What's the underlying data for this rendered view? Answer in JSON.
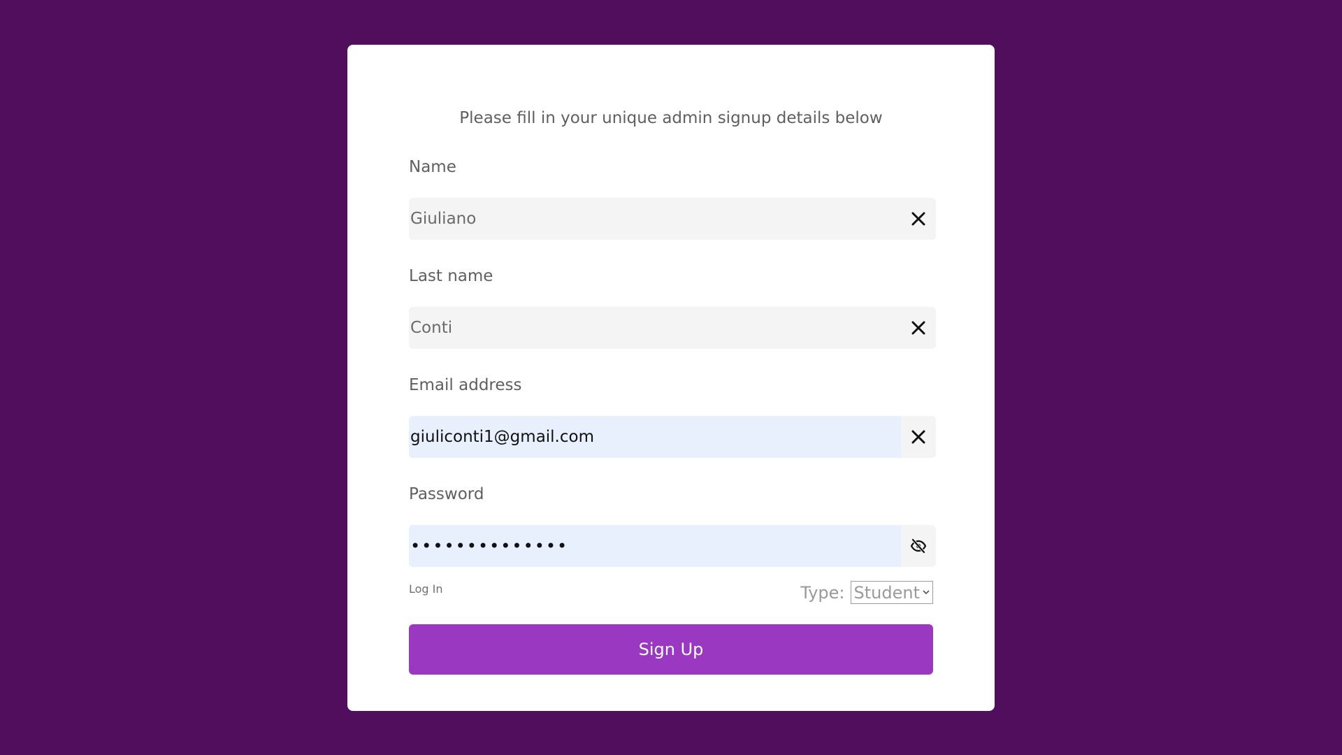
{
  "form": {
    "subtitle": "Please fill in your unique admin signup details below",
    "name": {
      "label": "Name",
      "value": "Giuliano"
    },
    "last_name": {
      "label": "Last name",
      "value": "Conti"
    },
    "email": {
      "label": "Email address",
      "value": "giuliconti1@gmail.com"
    },
    "password": {
      "label": "Password",
      "value": "••••••••••••••"
    },
    "login_link": "Log In",
    "type": {
      "label": "Type:",
      "selected": "Student"
    },
    "submit_label": "Sign Up"
  },
  "colors": {
    "background": "#510e5c",
    "card": "#ffffff",
    "button": "#9b38c2",
    "autofill": "#e8f0fd"
  },
  "icons": {
    "clear": "close-icon",
    "password_toggle": "eye-off-icon",
    "select": "chevron-down-icon"
  }
}
